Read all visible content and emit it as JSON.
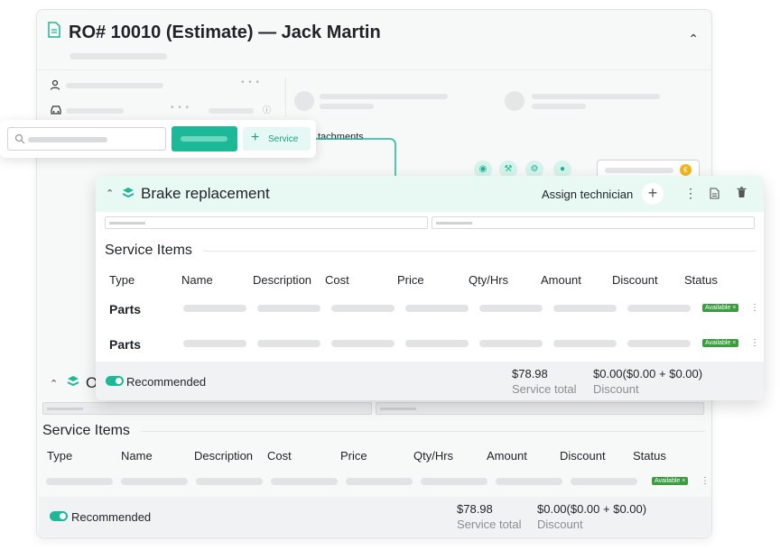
{
  "repair_order": {
    "title": "RO# 10010 (Estimate) — Jack Martin",
    "collapse_icon": "chevron-up-icon"
  },
  "tabs": {
    "attachments_fragment": "tachments"
  },
  "search_popup": {
    "add_service_label": "Service"
  },
  "front_service": {
    "name": "Brake replacement",
    "assign_label": "Assign technician",
    "section_title": "Service Items",
    "columns": [
      "Type",
      "Name",
      "Description",
      "Cost",
      "Price",
      "Qty/Hrs",
      "Amount",
      "Discount",
      "Status"
    ],
    "rows": [
      {
        "type": "Parts",
        "status": "Available ×"
      },
      {
        "type": "Parts",
        "status": "Available ×"
      }
    ],
    "recommended_label": "Recommended",
    "service_total": "$78.98",
    "service_total_label": "Service total",
    "discount": "$0.00($0.00 + $0.00)",
    "discount_label": "Discount"
  },
  "back_service": {
    "name_fragment": "O",
    "section_title": "Service Items",
    "columns": [
      "Type",
      "Name",
      "Description",
      "Cost",
      "Price",
      "Qty/Hrs",
      "Amount",
      "Discount",
      "Status"
    ],
    "row_status": "Available ×",
    "recommended_label": "Recommended",
    "service_total": "$78.98",
    "service_total_label": "Service total",
    "discount": "$0.00($0.00 + $0.00)",
    "discount_label": "Discount"
  },
  "colors": {
    "accent": "#1db898",
    "header_tint": "#e8f8f3",
    "badge": "#3a9d3f",
    "coin": "#f2b51d"
  }
}
